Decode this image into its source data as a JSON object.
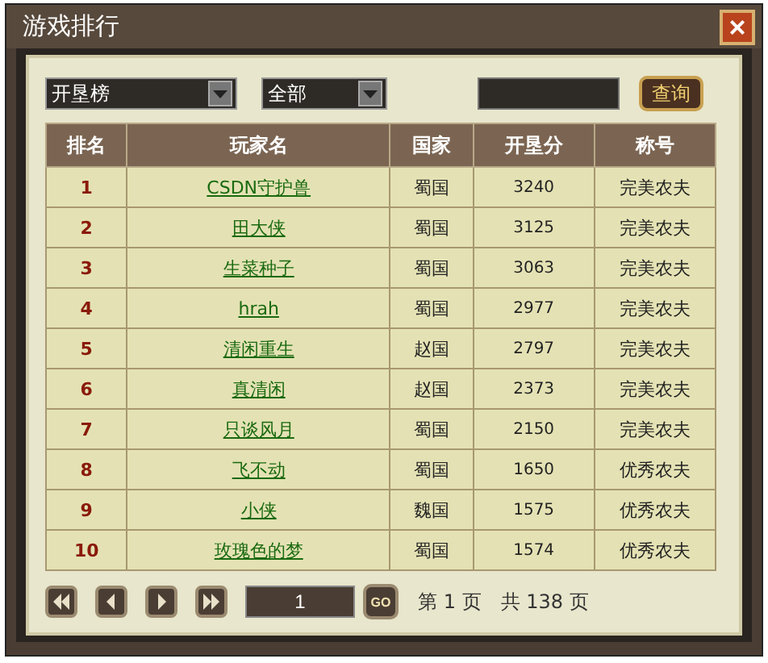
{
  "window": {
    "title": "游戏排行",
    "close": "×"
  },
  "filters": {
    "ranking": {
      "value": "开垦榜"
    },
    "scope": {
      "value": "全部"
    },
    "query_button": "查询"
  },
  "table": {
    "columns": [
      "排名",
      "玩家名",
      "国家",
      "开垦分",
      "称号"
    ],
    "rows": [
      {
        "rank": "1",
        "player": "CSDN守护兽",
        "country": "蜀国",
        "score": "3240",
        "title": "完美农夫"
      },
      {
        "rank": "2",
        "player": "田大侠",
        "country": "蜀国",
        "score": "3125",
        "title": "完美农夫"
      },
      {
        "rank": "3",
        "player": "生菜种子",
        "country": "蜀国",
        "score": "3063",
        "title": "完美农夫"
      },
      {
        "rank": "4",
        "player": "hrah",
        "country": "蜀国",
        "score": "2977",
        "title": "完美农夫"
      },
      {
        "rank": "5",
        "player": "清闲重生",
        "country": "赵国",
        "score": "2797",
        "title": "完美农夫"
      },
      {
        "rank": "6",
        "player": "真清闲",
        "country": "赵国",
        "score": "2373",
        "title": "完美农夫"
      },
      {
        "rank": "7",
        "player": "只谈风月",
        "country": "蜀国",
        "score": "2150",
        "title": "完美农夫"
      },
      {
        "rank": "8",
        "player": "飞不动",
        "country": "蜀国",
        "score": "1650",
        "title": "优秀农夫"
      },
      {
        "rank": "9",
        "player": "小侠",
        "country": "魏国",
        "score": "1575",
        "title": "优秀农夫"
      },
      {
        "rank": "10",
        "player": "玫瑰色的梦",
        "country": "蜀国",
        "score": "1574",
        "title": "优秀农夫"
      }
    ]
  },
  "pagination": {
    "page_input": "1",
    "go_button": "GO",
    "current": "第 1 页",
    "total": "共 138 页"
  }
}
